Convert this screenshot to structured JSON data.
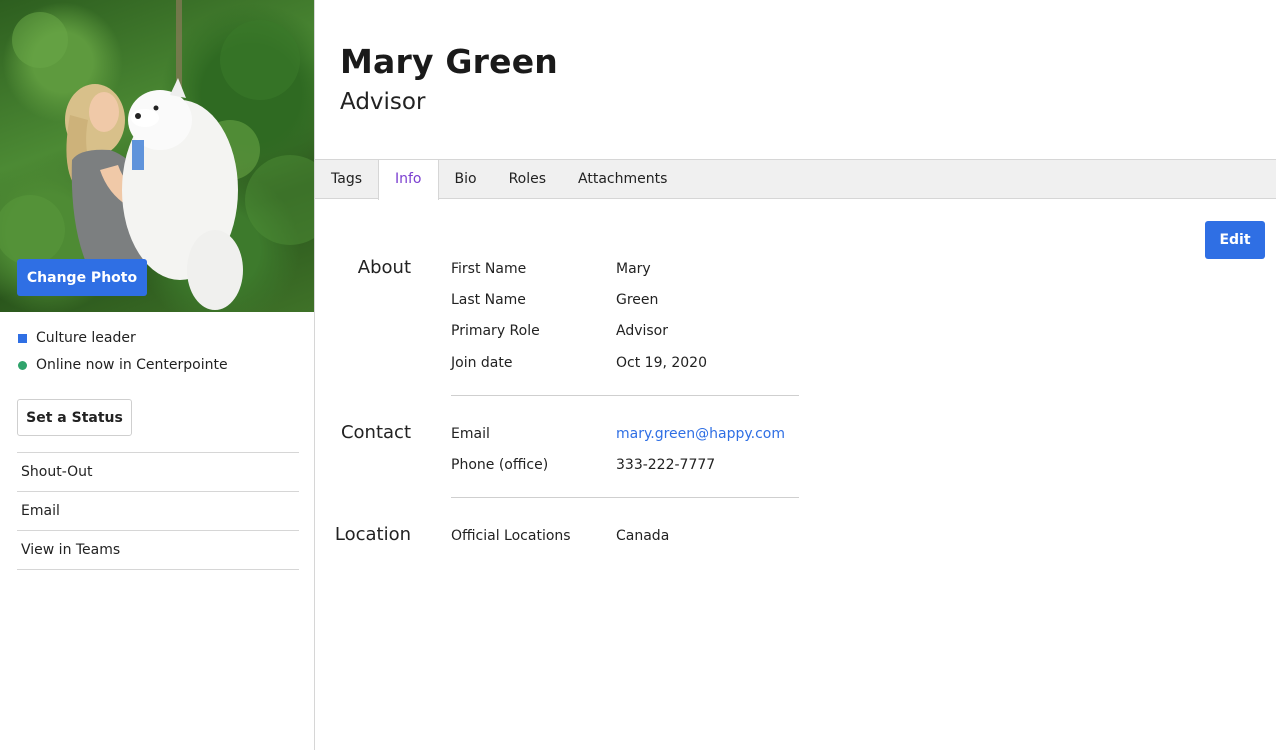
{
  "profile": {
    "name": "Mary Green",
    "title": "Advisor",
    "change_photo_label": "Change Photo",
    "status_items": [
      {
        "label": "Culture leader",
        "color": "#2f6fe4"
      },
      {
        "label": "Online now in Centerpointe",
        "color": "#2fa36b"
      }
    ],
    "set_status_label": "Set a Status",
    "side_links": [
      "Shout-Out",
      "Email",
      "View in Teams"
    ]
  },
  "tabs": [
    {
      "label": "Tags",
      "active": false
    },
    {
      "label": "Info",
      "active": true
    },
    {
      "label": "Bio",
      "active": false
    },
    {
      "label": "Roles",
      "active": false
    },
    {
      "label": "Attachments",
      "active": false
    }
  ],
  "edit_label": "Edit",
  "sections": {
    "about": {
      "label": "About",
      "rows": [
        {
          "label": "First Name",
          "value": "Mary"
        },
        {
          "label": "Last Name",
          "value": "Green"
        },
        {
          "label": "Primary Role",
          "value": "Advisor"
        },
        {
          "label": "Join date",
          "value": "Oct 19, 2020"
        }
      ]
    },
    "contact": {
      "label": "Contact",
      "rows": [
        {
          "label": "Email",
          "value": "mary.green@happy.com"
        },
        {
          "label": "Phone (office)",
          "value": "333-222-7777"
        }
      ]
    },
    "location": {
      "label": "Location",
      "rows": [
        {
          "label": "Official Locations",
          "value": "Canada"
        }
      ]
    }
  },
  "colors": {
    "accent": "#2f6fe4",
    "active_tab": "#7b3fd0",
    "online": "#2fa36b"
  }
}
